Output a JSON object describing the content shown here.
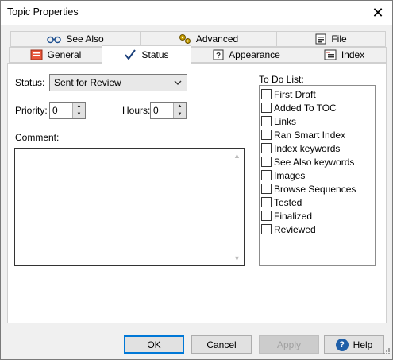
{
  "window": {
    "title": "Topic Properties"
  },
  "tabs_back": [
    {
      "label": "See Also",
      "icon": "glasses-icon"
    },
    {
      "label": "Advanced",
      "icon": "gears-icon"
    },
    {
      "label": "File",
      "icon": "file-icon"
    }
  ],
  "tabs_front": [
    {
      "label": "General",
      "icon": "general-icon"
    },
    {
      "label": "Status",
      "icon": "checkmark-icon",
      "active": true
    },
    {
      "label": "Appearance",
      "icon": "question-box-icon"
    },
    {
      "label": "Index",
      "icon": "index-icon"
    }
  ],
  "status": {
    "label": "Status:",
    "value": "Sent for Review"
  },
  "priority": {
    "label": "Priority:",
    "value": "0"
  },
  "hours": {
    "label": "Hours:",
    "value": "0"
  },
  "comment": {
    "label": "Comment:",
    "value": ""
  },
  "todo": {
    "label": "To Do List:",
    "items": [
      {
        "label": "First Draft",
        "checked": false
      },
      {
        "label": "Added To TOC",
        "checked": false
      },
      {
        "label": "Links",
        "checked": false
      },
      {
        "label": "Ran Smart Index",
        "checked": false
      },
      {
        "label": "Index keywords",
        "checked": false
      },
      {
        "label": "See Also keywords",
        "checked": false
      },
      {
        "label": "Images",
        "checked": false
      },
      {
        "label": "Browse Sequences",
        "checked": false
      },
      {
        "label": "Tested",
        "checked": false
      },
      {
        "label": "Finalized",
        "checked": false
      },
      {
        "label": "Reviewed",
        "checked": false
      }
    ]
  },
  "buttons": {
    "ok": "OK",
    "cancel": "Cancel",
    "apply": "Apply",
    "help": "Help"
  },
  "colors": {
    "accent": "#0078d7",
    "help_icon": "#1f5fa8"
  }
}
